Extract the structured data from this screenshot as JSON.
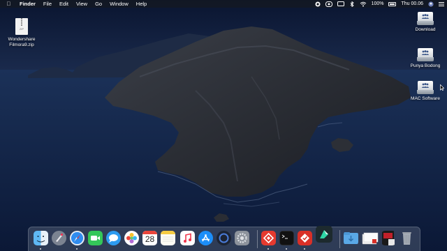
{
  "menubar": {
    "app_name": "Finder",
    "menus": [
      "File",
      "Edit",
      "View",
      "Go",
      "Window",
      "Help"
    ],
    "status": {
      "battery": "100%",
      "clock": "Thu 00.06"
    }
  },
  "desktop": {
    "files": [
      {
        "name_line1": "Wondershare",
        "name_line2": "Filmora9.zip",
        "icon": "zip-archive-icon",
        "tag": "ZIP"
      }
    ],
    "drives": [
      {
        "name": "Download",
        "icon": "network-drive-icon"
      },
      {
        "name": "Punya Bodong",
        "icon": "network-drive-icon"
      },
      {
        "name": "MAC Software",
        "icon": "network-drive-icon"
      }
    ]
  },
  "dock": {
    "apps": [
      {
        "name": "finder",
        "icon": "finder-icon",
        "running": true
      },
      {
        "name": "launchpad",
        "icon": "launchpad-icon",
        "running": false
      },
      {
        "name": "safari",
        "icon": "safari-icon",
        "running": true
      },
      {
        "name": "facetime",
        "icon": "facetime-icon",
        "running": false
      },
      {
        "name": "messages",
        "icon": "messages-icon",
        "running": false
      },
      {
        "name": "photos",
        "icon": "photos-icon",
        "running": false
      },
      {
        "name": "calendar",
        "icon": "calendar-icon",
        "running": false,
        "label": "28"
      },
      {
        "name": "notes",
        "icon": "notes-icon",
        "running": false
      },
      {
        "name": "music",
        "icon": "music-icon",
        "running": false
      },
      {
        "name": "app-store",
        "icon": "app-store-icon",
        "running": false
      },
      {
        "name": "screen-time",
        "icon": "dark-circle-icon",
        "running": false
      },
      {
        "name": "system-preferences",
        "icon": "gear-icon",
        "running": false
      },
      {
        "name": "anydesk-red",
        "icon": "red-diamond-icon",
        "running": true
      },
      {
        "name": "terminal",
        "icon": "terminal-icon",
        "running": true
      },
      {
        "name": "remote-app",
        "icon": "red-diamond-check-icon",
        "running": true
      },
      {
        "name": "filmora",
        "icon": "filmora-icon",
        "running": false
      },
      {
        "name": "downloads-stack",
        "icon": "folder-icon",
        "running": false
      },
      {
        "name": "screenshots-stack",
        "icon": "image-stack-icon",
        "running": false
      },
      {
        "name": "media-stack",
        "icon": "media-stack-icon",
        "running": false
      },
      {
        "name": "trash",
        "icon": "trash-icon",
        "running": false
      }
    ]
  },
  "colors": {
    "menubar_bg": "#141822",
    "sky_top": "#0c1733",
    "sea": "#102448",
    "island": "#2b2e36"
  }
}
